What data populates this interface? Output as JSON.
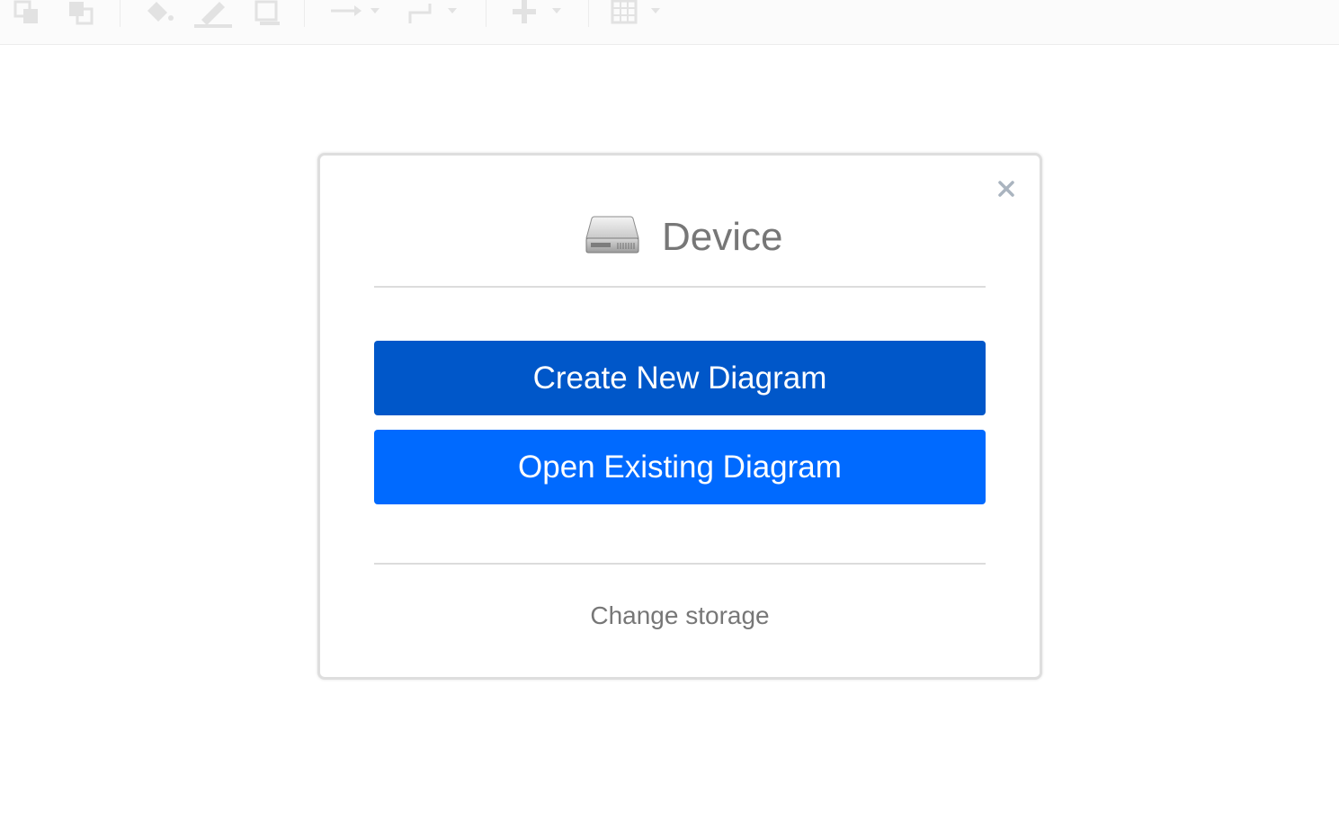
{
  "toolbar": {
    "icons": [
      "to-back-icon",
      "to-front-icon",
      "fill-color-icon",
      "line-color-icon",
      "shadow-icon",
      "connection-arrow-icon",
      "waypoints-icon",
      "insert-plus-icon",
      "table-icon"
    ]
  },
  "dialog": {
    "title": "Device",
    "create_label": "Create New Diagram",
    "open_label": "Open Existing Diagram",
    "change_storage_label": "Change storage",
    "close_icon": "close-icon"
  },
  "colors": {
    "create_button": "#0057c9",
    "open_button": "#006aff",
    "muted_text": "#777777",
    "close_x": "#aab4bf"
  }
}
